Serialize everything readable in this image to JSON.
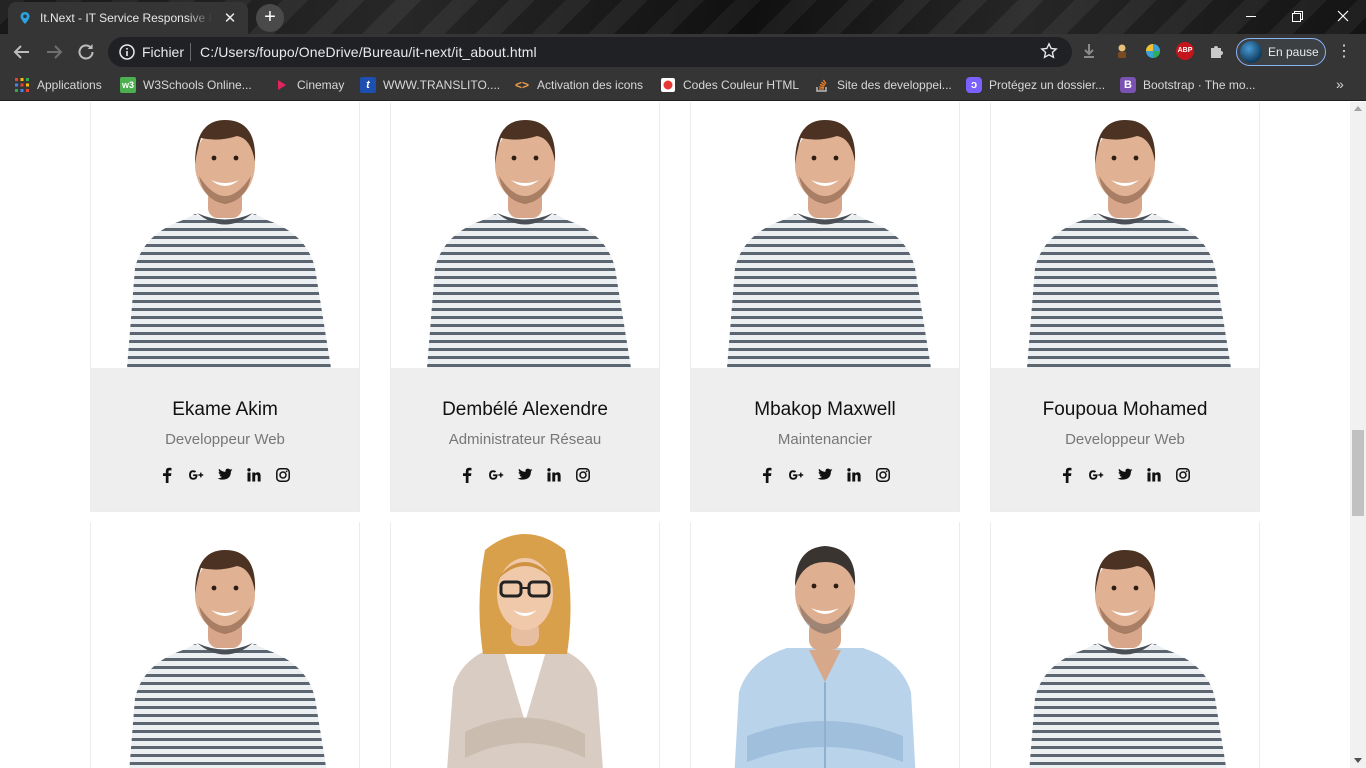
{
  "browser": {
    "tab_title": "It.Next - IT Service Responsive Html",
    "scheme_label": "Fichier",
    "url": "C:/Users/foupo/OneDrive/Bureau/it-next/it_about.html",
    "profile_label": "En pause",
    "extension_abp_label": "ABP",
    "bookmarks": [
      {
        "label": "Applications",
        "icon": "apps-grid-icon"
      },
      {
        "label": "W3Schools Online...",
        "icon": "w3schools-icon"
      },
      {
        "label": "Cinemay",
        "icon": "play-icon"
      },
      {
        "label": "WWW.TRANSLITO....",
        "icon": "translito-icon"
      },
      {
        "label": "Activation des icons",
        "icon": "code-brackets-icon"
      },
      {
        "label": "Codes Couleur HTML",
        "icon": "color-icon"
      },
      {
        "label": "Site des developpei...",
        "icon": "stackoverflow-icon"
      },
      {
        "label": "Protégez un dossier...",
        "icon": "lock-folder-icon"
      },
      {
        "label": "Bootstrap · The mo...",
        "icon": "bootstrap-icon"
      }
    ]
  },
  "team": [
    {
      "name": "Ekame Akim",
      "role": "Developpeur Web",
      "photo": "man-striped-shirt"
    },
    {
      "name": "Dembélé Alexendre",
      "role": "Administrateur Réseau",
      "photo": "man-striped-shirt"
    },
    {
      "name": "Mbakop Maxwell",
      "role": "Maintenancier",
      "photo": "man-striped-shirt"
    },
    {
      "name": "Foupoua Mohamed",
      "role": "Developpeur Web",
      "photo": "man-striped-shirt"
    },
    {
      "photo": "man-striped-shirt"
    },
    {
      "photo": "woman-blazer-glasses"
    },
    {
      "photo": "man-denim-shirt"
    },
    {
      "photo": "man-striped-shirt"
    }
  ],
  "social_icons": [
    "facebook-icon",
    "google-plus-icon",
    "twitter-icon",
    "linkedin-icon",
    "instagram-icon"
  ],
  "colors": {
    "chrome_dark": "#353535",
    "card_info_bg": "#eeeeee",
    "name_text": "#111111",
    "role_text": "#777777",
    "profile_border": "#8ab4f8"
  }
}
